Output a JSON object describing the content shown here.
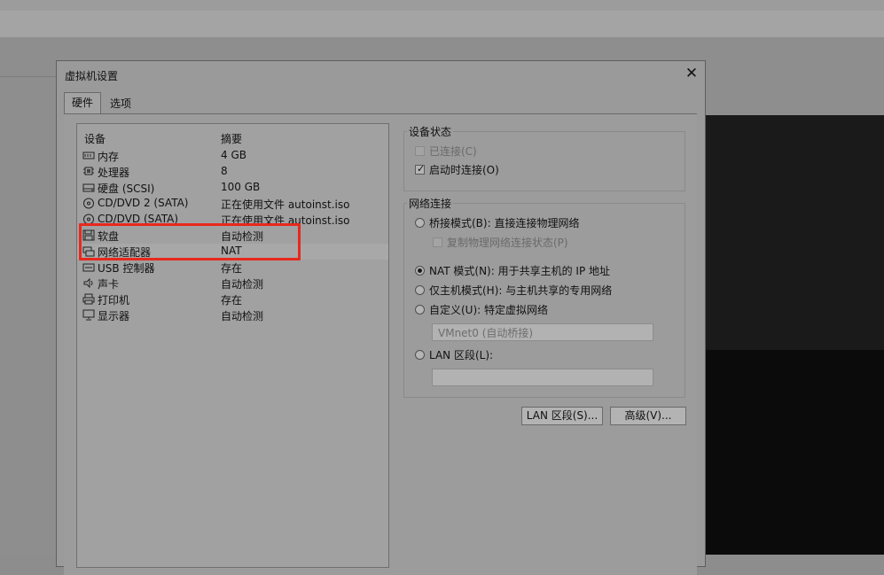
{
  "dialog": {
    "title": "虚拟机设置",
    "close": "✕",
    "tabs": [
      {
        "label": "硬件",
        "active": true
      },
      {
        "label": "选项",
        "active": false
      }
    ]
  },
  "device_list": {
    "header_device": "设备",
    "header_summary": "摘要",
    "rows": [
      {
        "name": "内存",
        "summary": "4 GB",
        "icon": "memory-icon"
      },
      {
        "name": "处理器",
        "summary": "8",
        "icon": "cpu-icon"
      },
      {
        "name": "硬盘 (SCSI)",
        "summary": "100 GB",
        "icon": "hard-disk-icon"
      },
      {
        "name": "CD/DVD 2 (SATA)",
        "summary": "正在使用文件 autoinst.iso",
        "icon": "cd-dvd-icon"
      },
      {
        "name": "CD/DVD (SATA)",
        "summary": "正在使用文件 autoinst.iso",
        "icon": "cd-dvd-icon"
      },
      {
        "name": "软盘",
        "summary": "自动检测",
        "icon": "floppy-icon"
      },
      {
        "name": "网络适配器",
        "summary": "NAT",
        "icon": "network-adapter-icon",
        "selected": true
      },
      {
        "name": "USB 控制器",
        "summary": "存在",
        "icon": "usb-icon"
      },
      {
        "name": "声卡",
        "summary": "自动检测",
        "icon": "speaker-icon"
      },
      {
        "name": "打印机",
        "summary": "存在",
        "icon": "printer-icon"
      },
      {
        "name": "显示器",
        "summary": "自动检测",
        "icon": "monitor-icon"
      }
    ]
  },
  "device_status": {
    "title": "设备状态",
    "connected": {
      "label": "已连接(C)",
      "checked": false,
      "disabled": true
    },
    "connect_on_power": {
      "label": "启动时连接(O)",
      "checked": true
    }
  },
  "network": {
    "title": "网络连接",
    "bridged": {
      "label": "桥接模式(B): 直接连接物理网络",
      "selected": false
    },
    "replicate": {
      "label": "复制物理网络连接状态(P)",
      "disabled": true
    },
    "nat": {
      "label": "NAT 模式(N): 用于共享主机的 IP 地址",
      "selected": true
    },
    "host_only": {
      "label": "仅主机模式(H): 与主机共享的专用网络",
      "selected": false
    },
    "custom": {
      "label": "自定义(U): 特定虚拟网络",
      "selected": false
    },
    "custom_value": "VMnet0 (自动桥接)",
    "lan_segment": {
      "label": "LAN 区段(L):",
      "selected": false
    },
    "lan_segment_value": ""
  },
  "buttons": {
    "lan_segments": "LAN 区段(S)...",
    "advanced": "高级(V)..."
  },
  "colors": {
    "highlight": "#e8281d"
  }
}
